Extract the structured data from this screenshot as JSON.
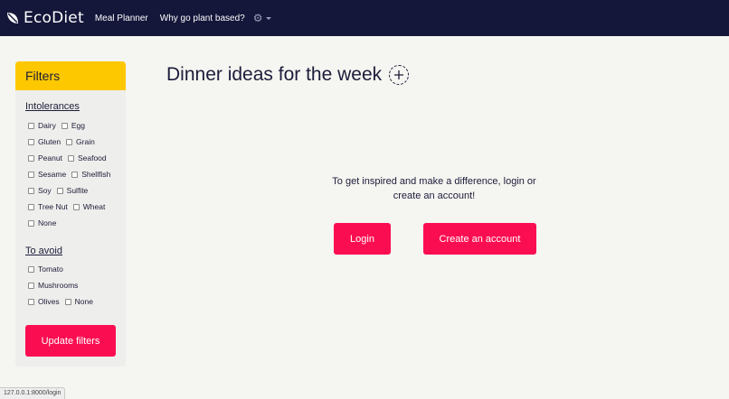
{
  "navbar": {
    "brand": "EcoDiet",
    "links": [
      {
        "label": "Meal Planner"
      },
      {
        "label": "Why go plant based?"
      }
    ],
    "settings_icon": "gear-icon"
  },
  "filters": {
    "title": "Filters",
    "intolerances": {
      "title": "Intolerances",
      "options": [
        "Dairy",
        "Egg",
        "Gluten",
        "Grain",
        "Peanut",
        "Seafood",
        "Sesame",
        "Shellfish",
        "Soy",
        "Sulfite",
        "Tree Nut",
        "Wheat",
        "None"
      ]
    },
    "to_avoid": {
      "title": "To avoid",
      "options": [
        "Tomato",
        "Mushrooms",
        "Olives",
        "None"
      ]
    },
    "update_label": "Update filters"
  },
  "main": {
    "title": "Dinner ideas for the week",
    "prompt_line1": "To get inspired and make a difference, login or",
    "prompt_line2": "create an account!",
    "login_label": "Login",
    "create_label": "Create an account"
  },
  "status_url": "127.0.0.1:8000/login",
  "colors": {
    "navbar": "#14163a",
    "accent": "#fb0e51",
    "filters_header": "#fec800",
    "background": "#f5f5f1"
  }
}
